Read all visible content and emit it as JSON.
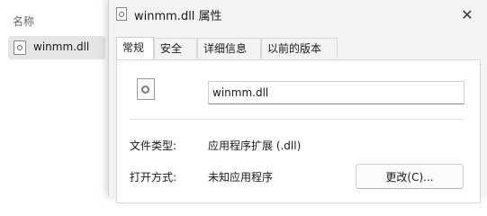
{
  "explorer": {
    "column_header": "名称",
    "file_name": "winmm.dll"
  },
  "dialog": {
    "title": "winmm.dll 属性",
    "tabs": [
      {
        "label": "常规",
        "active": true
      },
      {
        "label": "安全",
        "active": false
      },
      {
        "label": "详细信息",
        "active": false
      },
      {
        "label": "以前的版本",
        "active": false
      }
    ],
    "general": {
      "file_name_value": "winmm.dll",
      "file_type_label": "文件类型:",
      "file_type_value": "应用程序扩展 (.dll)",
      "opens_with_label": "打开方式:",
      "opens_with_value": "未知应用程序",
      "change_button": "更改(C)..."
    }
  },
  "icons": {
    "file": "dll-file-icon",
    "close": "close-icon",
    "settings_file": "settings-file-icon"
  }
}
